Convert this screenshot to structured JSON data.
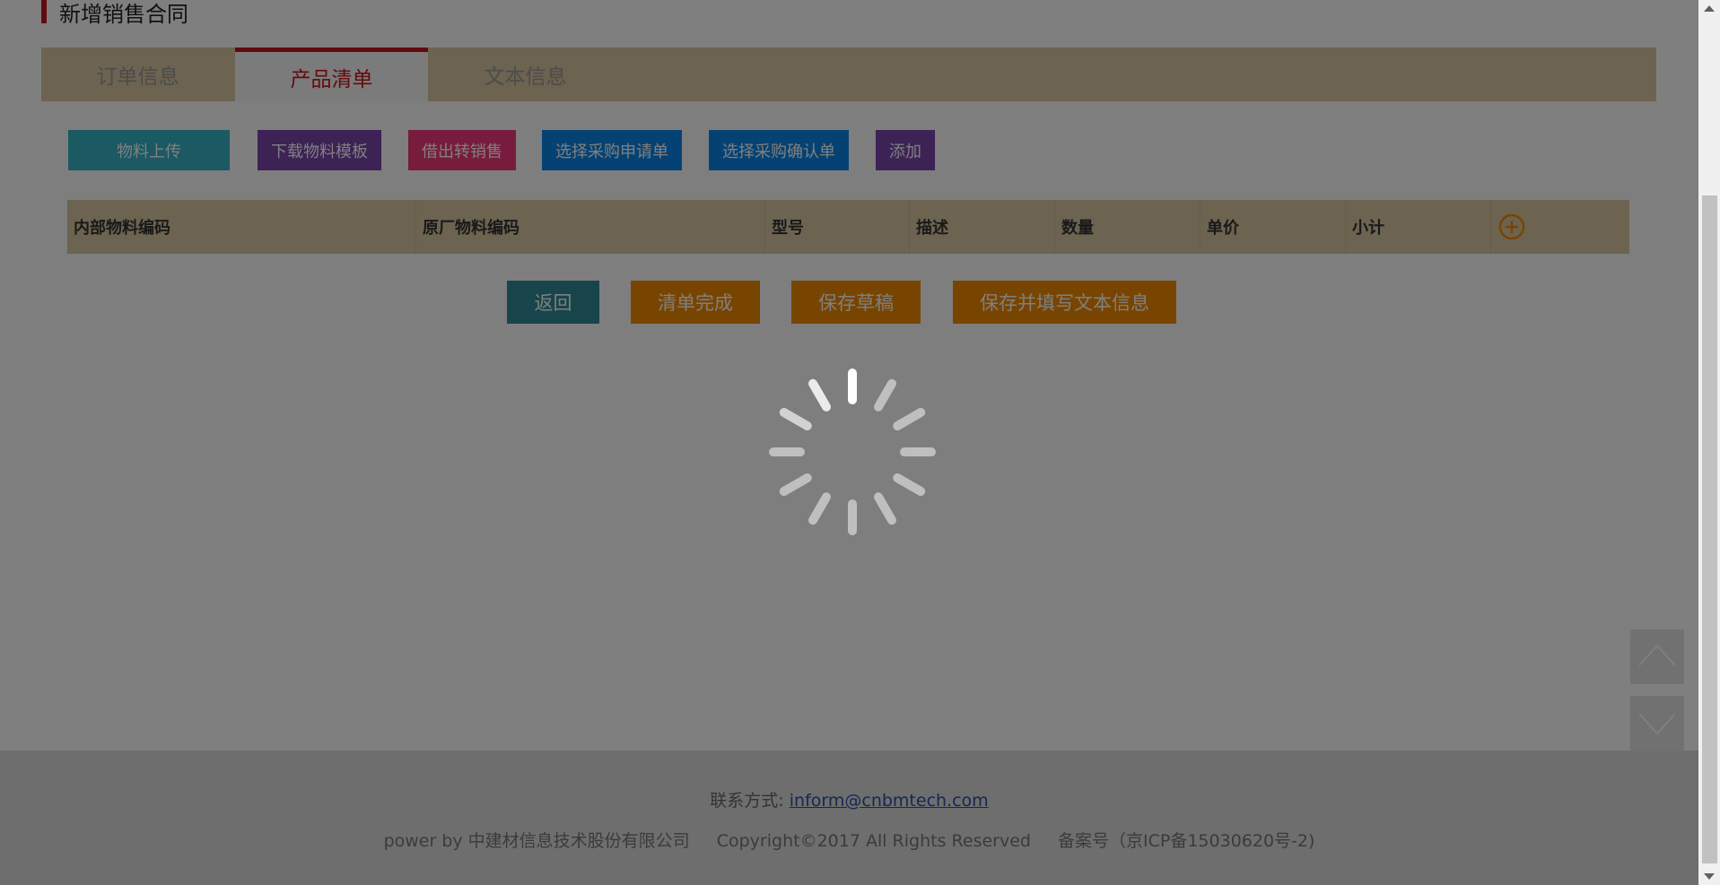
{
  "page": {
    "title": "新增销售合同"
  },
  "tabs": [
    {
      "label": "订单信息",
      "active": false
    },
    {
      "label": "产品清单",
      "active": true
    },
    {
      "label": "文本信息",
      "active": false
    }
  ],
  "toolbar": {
    "upload_label": "物料上传",
    "download_template_label": "下载物料模板",
    "lend_to_sale_label": "借出转销售",
    "select_purchase_request_label": "选择采购申请单",
    "select_purchase_confirm_label": "选择采购确认单",
    "add_label": "添加",
    "colors": {
      "upload": "#36b3c6",
      "download": "#7a45ad",
      "lend": "#f0397a",
      "select_request": "#0b84e8",
      "select_confirm": "#0b84e8",
      "add": "#7a45ad"
    }
  },
  "table": {
    "columns": [
      "内部物料编码",
      "原厂物料编码",
      "型号",
      "描述",
      "数量",
      "单价",
      "小计"
    ],
    "add_row_icon": "plus-circle-icon",
    "rows": []
  },
  "actions": {
    "back_label": "返回",
    "finish_label": "清单完成",
    "save_draft_label": "保存草稿",
    "save_fill_text_label": "保存并填写文本信息",
    "colors": {
      "back": "#2f8a96",
      "orange": "#f08a00"
    }
  },
  "footer": {
    "contact_label": "联系方式:",
    "contact_email": "inform@cnbmtech.com",
    "power_by": "power by 中建材信息技术股份有限公司",
    "copyright": "Copyright©2017 All Rights Reserved",
    "icp": "备案号（京ICP备15030620号-2)"
  },
  "side_nav": {
    "up_icon": "chevron-up-icon",
    "down_icon": "chevron-down-icon"
  },
  "loading": {
    "state": "loading",
    "icon": "spinner-icon"
  },
  "accent_color": "#c5161d",
  "table_header_bg": "#d9c7a0"
}
